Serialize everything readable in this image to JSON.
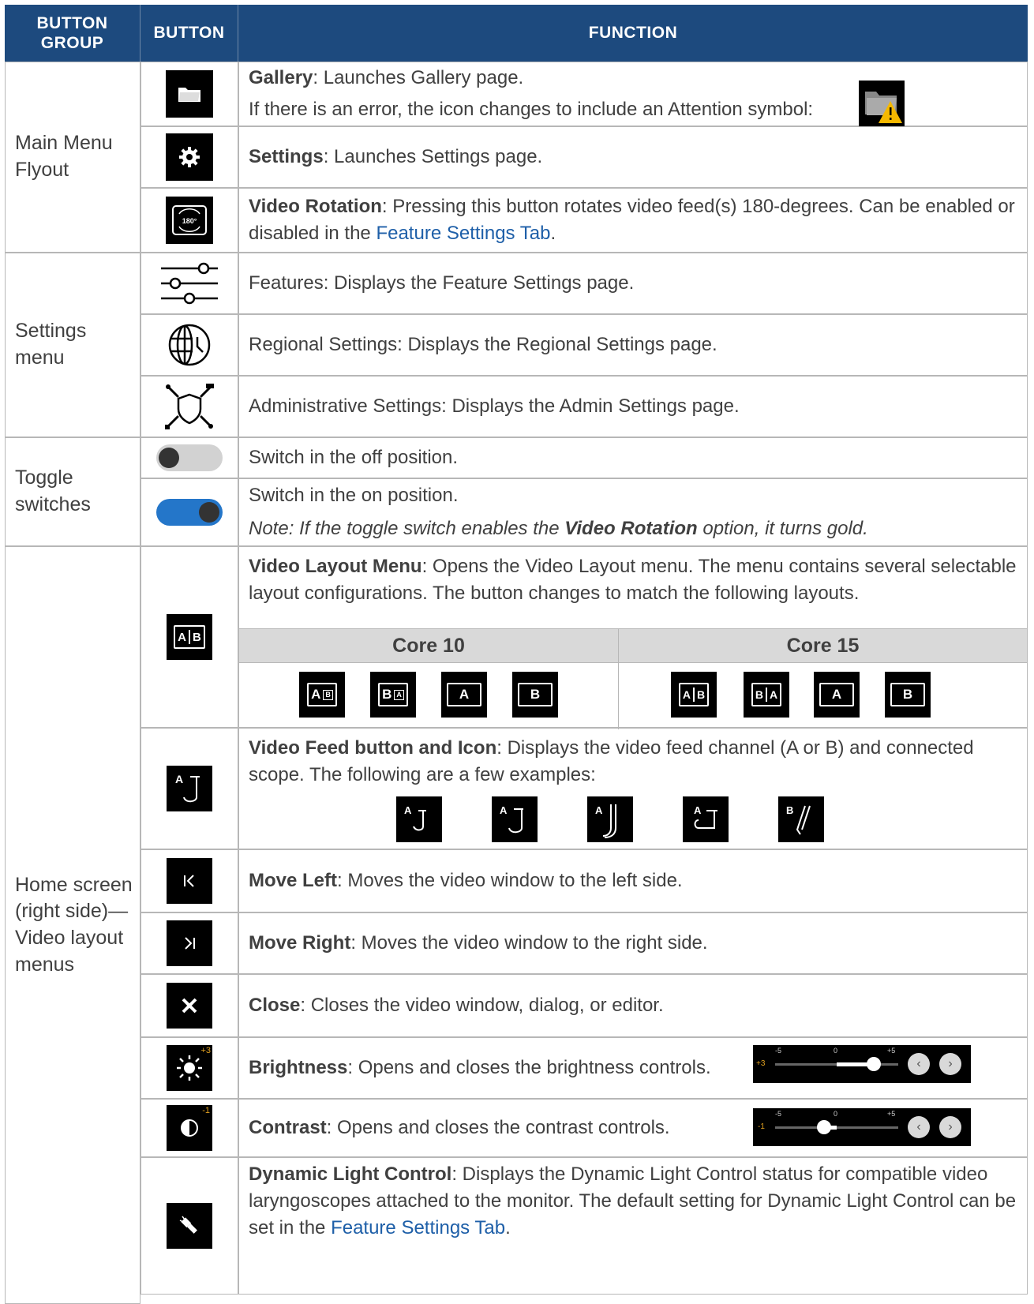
{
  "header": {
    "group": "BUTTON GROUP",
    "button": "BUTTON",
    "function": "FUNCTION"
  },
  "groups": {
    "main_menu": "Main Menu Flyout",
    "settings_menu": "Settings menu",
    "toggle": "Toggle switches",
    "home": "Home screen (right side)— Video layout menus"
  },
  "rows": {
    "gallery": {
      "title": "Gallery",
      "desc": ": Launches Gallery page.",
      "error_note": "If there is an error, the icon changes to include an Attention symbol:"
    },
    "settings": {
      "title": "Settings",
      "desc": ": Launches Settings page."
    },
    "rotation": {
      "title": "Video Rotation",
      "desc": ": Pressing this button rotates video feed(s) 180-degrees. Can be enabled or disabled in the ",
      "link": "Feature Settings Tab",
      "end": ".",
      "icon_text": "180°"
    },
    "features": {
      "text": "Features: Displays the Feature Settings page."
    },
    "regional": {
      "text": "Regional Settings: Displays the Regional Settings page."
    },
    "admin": {
      "text": "Administrative Settings: Displays the Admin Settings page."
    },
    "toggle_off": {
      "text": "Switch in the off position."
    },
    "toggle_on": {
      "text": "Switch in the on position.",
      "note_pre": "Note: If the toggle switch enables the ",
      "note_bold": "Video Rotation",
      "note_post": " option, it turns gold."
    },
    "layout": {
      "title": "Video Layout Menu",
      "desc": ": Opens the Video Layout menu. The menu contains several selectable layout configurations. The button changes to match the following layouts.",
      "core10": "Core 10",
      "core15": "Core 15",
      "labels": {
        "a": "A",
        "b": "B"
      }
    },
    "feed": {
      "title": "Video Feed button and Icon",
      "desc": ": Displays the video feed channel (A or B) and connected scope. The following are a few examples:"
    },
    "move_left": {
      "title": "Move Left",
      "desc": ": Moves the video window to the left side."
    },
    "move_right": {
      "title": "Move Right",
      "desc": ": Moves the video window to the right side."
    },
    "close": {
      "title": "Close",
      "desc": ": Closes the video window, dialog, or editor."
    },
    "brightness": {
      "title": "Brightness",
      "desc": ": Opens and closes the brightness controls.",
      "icon_value": "+3",
      "slider": {
        "value_label": "+3",
        "min_label": "-5",
        "mid_label": "0",
        "max_label": "+5",
        "value": 3
      }
    },
    "contrast": {
      "title": "Contrast",
      "desc": ": Opens and closes the contrast controls.",
      "icon_value": "-1",
      "slider": {
        "value_label": "-1",
        "min_label": "-5",
        "mid_label": "0",
        "max_label": "+5",
        "value": -1
      }
    },
    "dlc": {
      "title": "Dynamic Light Control",
      "desc": ": Displays the Dynamic Light Control status for compatible video laryngoscopes attached to the monitor. The default setting for Dynamic Light Control can be set in the ",
      "link": "Feature Settings Tab",
      "end": "."
    }
  },
  "colors": {
    "header_bg": "#1d4a7e",
    "link": "#1e5fa8",
    "toggle_on": "#2476c9",
    "toggle_off": "#d2d2d2",
    "attention": "#f5b800",
    "slider_value": "#e0a020"
  }
}
